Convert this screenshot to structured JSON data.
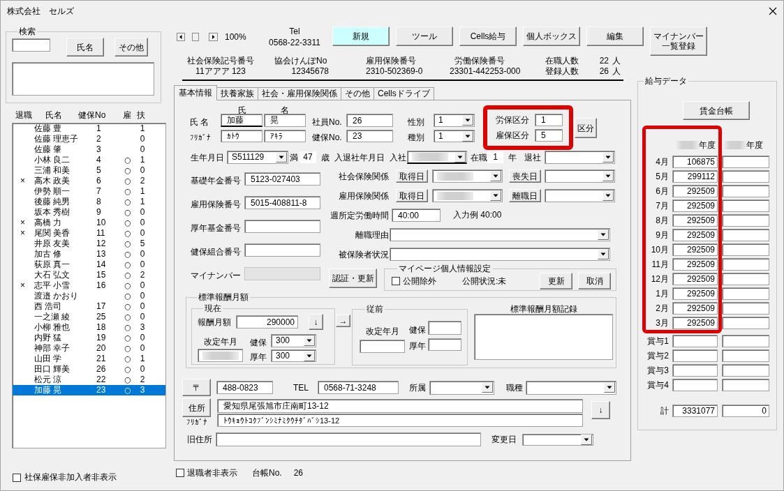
{
  "window": {
    "title": "株式会社　セルズ"
  },
  "search": {
    "title": "検索",
    "buttons": [
      "氏名",
      "その他"
    ]
  },
  "employee_list": {
    "columns": [
      "退職",
      "氏名",
      "健保No",
      "雇",
      "扶"
    ],
    "rows": [
      {
        "name": "佐藤 豊",
        "health_no": "1",
        "dependents": "1",
        "selected": false
      },
      {
        "name": "佐藤 理恵子",
        "health_no": "2",
        "dependents": "0",
        "selected": false
      },
      {
        "name": "佐藤 肇",
        "health_no": "3",
        "dependents": "0",
        "selected": false
      },
      {
        "name": "小林 良二",
        "health_no": "4",
        "employment": "○",
        "dependents": "1",
        "selected": false
      },
      {
        "name": "三浦 和美",
        "health_no": "5",
        "employment": "○",
        "dependents": "0",
        "selected": false
      },
      {
        "retired": "×",
        "name": "高木 政美",
        "health_no": "6",
        "employment": "○",
        "dependents": "2",
        "selected": false
      },
      {
        "name": "伊勢 順一",
        "health_no": "7",
        "employment": "○",
        "dependents": "1",
        "selected": false
      },
      {
        "name": "後藤 純男",
        "health_no": "8",
        "employment": "○",
        "dependents": "1",
        "selected": false
      },
      {
        "name": "坂本 秀樹",
        "health_no": "9",
        "employment": "○",
        "dependents": "0",
        "selected": false
      },
      {
        "retired": "×",
        "name": "高橋 力",
        "health_no": "10",
        "employment": "○",
        "dependents": "0",
        "selected": false
      },
      {
        "retired": "×",
        "name": "尾関 美香",
        "health_no": "11",
        "employment": "○",
        "dependents": "0",
        "selected": false
      },
      {
        "name": "井原 友美",
        "health_no": "12",
        "employment": "○",
        "dependents": "5",
        "selected": false
      },
      {
        "name": "加古 修",
        "health_no": "13",
        "employment": "○",
        "dependents": "0",
        "selected": false
      },
      {
        "name": "荻原 真一",
        "health_no": "14",
        "employment": "○",
        "dependents": "0",
        "selected": false
      },
      {
        "name": "大石 弘文",
        "health_no": "15",
        "employment": "○",
        "dependents": "2",
        "selected": false
      },
      {
        "retired": "×",
        "name": "志平 小雪",
        "health_no": "16",
        "employment": "○",
        "dependents": "0",
        "selected": false
      },
      {
        "name": "渡邉 かおり",
        "employment": "○",
        "dependents": "0",
        "selected": false
      },
      {
        "name": "西 浩司",
        "health_no": "17",
        "employment": "○",
        "dependents": "0",
        "selected": false
      },
      {
        "name": "一之瀬 綾",
        "health_no": "25",
        "employment": "○",
        "dependents": "0",
        "selected": false
      },
      {
        "name": "小柳 雅也",
        "health_no": "18",
        "employment": "○",
        "dependents": "3",
        "selected": false
      },
      {
        "name": "内野 猛",
        "health_no": "19",
        "employment": "○",
        "dependents": "0",
        "selected": false
      },
      {
        "name": "神部 幸子",
        "health_no": "20",
        "employment": "○",
        "dependents": "0",
        "selected": false
      },
      {
        "name": "山田 学",
        "health_no": "21",
        "employment": "○",
        "dependents": "1",
        "selected": false
      },
      {
        "name": "田口 輝美",
        "health_no": "26",
        "employment": "○",
        "dependents": "0",
        "selected": false
      },
      {
        "name": "松元 涼",
        "health_no": "22",
        "employment": "○",
        "dependents": "2",
        "selected": false
      },
      {
        "name": "加藤 晃",
        "health_no": "23",
        "employment": "○",
        "dependents": "3",
        "selected": true
      }
    ]
  },
  "hide_uninsured": {
    "label": "社保雇保非加入者非表示",
    "checked": false
  },
  "toolbar": {
    "zoom": "100%",
    "tel_label": "Tel",
    "tel": "0568-22-3311",
    "buttons": [
      {
        "label": "新規",
        "highlighted": true
      },
      {
        "label": "ツール",
        "highlighted": false
      },
      {
        "label": "Cells給与",
        "highlighted": false
      },
      {
        "label": "個人ボックス",
        "highlighted": false
      },
      {
        "label": "編集",
        "highlighted": false
      },
      {
        "label": "マイナンバー一覧登録",
        "highlighted": false
      }
    ]
  },
  "company": {
    "fields": [
      {
        "label": "社会保険記号番号",
        "value": "11アアア 123"
      },
      {
        "label": "協会けんぽNo",
        "value": "12345678"
      },
      {
        "label": "雇用保険番号",
        "value": "2310-502369-0"
      },
      {
        "label": "労働保険番号",
        "value": "23301-442253-000"
      }
    ],
    "headcounts": [
      {
        "label": "在職人数",
        "value": "22",
        "unit": "人"
      },
      {
        "label": "登録人数",
        "value": "26",
        "unit": "人"
      }
    ]
  },
  "tabs": [
    {
      "label": "基本情報",
      "selected": true
    },
    {
      "label": "扶養家族",
      "selected": false
    },
    {
      "label": "社会・雇用保険関係",
      "selected": false
    },
    {
      "label": "その他",
      "selected": false
    },
    {
      "label": "Cellsドライブ",
      "selected": false
    }
  ],
  "basic_info": {
    "name": {
      "heading_surname": "氏",
      "heading_given": "名",
      "label": "氏 名",
      "kana_label": "ﾌﾘｶﾞﾅ",
      "surname": {
        "value": "加藤",
        "underlined": true
      },
      "given_name": {
        "value": "晃",
        "underlined": false
      },
      "surname_kana": "ｶﾄｳ",
      "given_kana": "ｱｷﾗ"
    },
    "employee_no": {
      "label": "社員No.",
      "value": "26"
    },
    "health_no": {
      "label": "健保No.",
      "value": "23"
    },
    "gender": {
      "label": "性別",
      "value": "1"
    },
    "category": {
      "label": "種別",
      "value": "1"
    },
    "insurance_class": {
      "highlighted": true,
      "labour": {
        "label": "労保区分",
        "value": "1"
      },
      "employment": {
        "label": "雇保区分",
        "value": "5"
      },
      "button": "区分"
    },
    "birth": {
      "label": "生年月日",
      "value": "S511129",
      "age_prefix": "満",
      "age": "47",
      "age_unit": "歳"
    },
    "tenure": {
      "label": "入退社年月日",
      "join_label": "入社",
      "join_date": {
        "redacted": true,
        "underlined": true
      },
      "years_label": "在職",
      "years": "1",
      "years_unit": "年",
      "leave_label": "退社"
    },
    "id_numbers": [
      {
        "label": "基礎年金番号",
        "value": "5123-027403",
        "disabled": false
      },
      {
        "label": "雇用保険番号",
        "value": "5015-408811-8",
        "disabled": false
      },
      {
        "label": "厚年基金番号",
        "disabled": false
      },
      {
        "label": "健保組合番号",
        "disabled": false
      },
      {
        "label": "マイナンバー",
        "disabled": true
      }
    ],
    "insurance_dates": [
      {
        "label": "社会保険関係",
        "acquire_button": "取得日",
        "acquire_date": {
          "redacted": true
        },
        "loss_button": "喪失日"
      },
      {
        "label": "雇用保険関係",
        "acquire_button": "取得日",
        "acquire_date": {
          "redacted": true
        },
        "loss_button": "離職日"
      }
    ],
    "weekly_hours": {
      "label": "週所定労働時間",
      "value": "40:00",
      "example": "入力例 40:00"
    },
    "selects": [
      {
        "label": "離職理由"
      },
      {
        "label": "被保険者状況"
      }
    ],
    "auth_button": "認証・更新",
    "mypage": {
      "title": "マイページ個人情報設定",
      "exclude": {
        "label": "公開除外",
        "checked": false
      },
      "status": "公開状況:未",
      "buttons": [
        "更新",
        "取消"
      ]
    },
    "remuneration": {
      "title": "標準報酬月額",
      "current": {
        "title": "現在",
        "amount_label": "報酬月額",
        "amount": "290000",
        "copy_button": "↓",
        "revision_label": "改定年月",
        "revision": {
          "redacted": true
        },
        "health_label": "健保",
        "health": "300",
        "pension_label": "厚年",
        "pension": "300"
      },
      "move_button": "→",
      "previous": {
        "title": "従前",
        "revision_label": "改定年月",
        "health_label": "健保",
        "pension_label": "厚年"
      },
      "history_label": "標準報酬月額記録"
    },
    "address": {
      "postal_button": "〒",
      "postal": "488-0823",
      "tel_label": "TEL",
      "tel": "0568-71-3248",
      "department_label": "所属",
      "job_label": "職種",
      "address_button": "住所",
      "address": "愛知県尾張旭市庄南町13-12",
      "kana_label": "ﾌﾘｶﾞﾅ",
      "kana": "ﾄｳｷｮｳﾄｺｸﾌﾞﾝｼﾐﾅﾐｸｳﾁﾀﾞﾊﾞｼ13-12",
      "copy_button": "↓",
      "old_address_label": "旧住所",
      "change_date_label": "変更日"
    }
  },
  "footer": {
    "hide_retired": {
      "label": "退職者非表示",
      "checked": false
    },
    "ledger_label": "台帳No.",
    "ledger_no": "26"
  },
  "salary": {
    "title": "給与データ",
    "ledger_button": "賃金台帳",
    "year_headers": [
      {
        "label": "年度",
        "redacted": true
      },
      {
        "label": "年度",
        "redacted": true
      }
    ],
    "months": {
      "highlighted": true,
      "rows": [
        {
          "label": "4月",
          "values": [
            "106875"
          ]
        },
        {
          "label": "5月",
          "values": [
            "299112"
          ]
        },
        {
          "label": "6月",
          "values": [
            "292509"
          ]
        },
        {
          "label": "7月",
          "values": [
            "292509"
          ]
        },
        {
          "label": "8月",
          "values": [
            "292509"
          ]
        },
        {
          "label": "9月",
          "values": [
            "292509"
          ]
        },
        {
          "label": "10月",
          "values": [
            "292509"
          ]
        },
        {
          "label": "11月",
          "values": [
            "292509"
          ]
        },
        {
          "label": "12月",
          "values": [
            "292509"
          ]
        },
        {
          "label": "1月",
          "values": [
            "292509"
          ]
        },
        {
          "label": "2月",
          "values": [
            "292509"
          ]
        },
        {
          "label": "3月",
          "values": [
            "292509"
          ]
        }
      ]
    },
    "bonuses": [
      {
        "label": "賞与1"
      },
      {
        "label": "賞与2"
      },
      {
        "label": "賞与3"
      },
      {
        "label": "賞与4"
      }
    ],
    "total": {
      "label": "計",
      "values": [
        "3331077",
        "0"
      ]
    }
  }
}
